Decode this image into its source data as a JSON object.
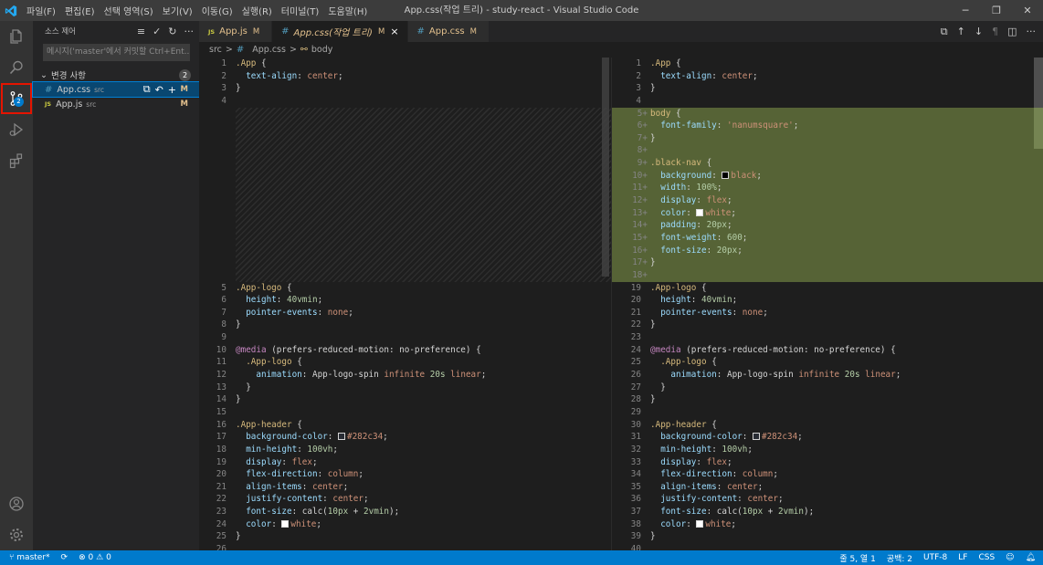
{
  "window": {
    "title": "App.css(작업 트리) - study-react - Visual Studio Code",
    "menu": [
      "파일(F)",
      "편집(E)",
      "선택 영역(S)",
      "보기(V)",
      "이동(G)",
      "실행(R)",
      "터미널(T)",
      "도움말(H)"
    ]
  },
  "activity": {
    "scm_badge": "2"
  },
  "sidebar": {
    "title": "소스 제어",
    "commit_placeholder": "메시지('master'에서 커밋할 Ctrl+Ent...",
    "changes_label": "변경 사항",
    "changes_count": "2",
    "files": [
      {
        "name": "App.css",
        "dir": "src",
        "status": "M",
        "type": "css",
        "selected": true
      },
      {
        "name": "App.js",
        "dir": "src",
        "status": "M",
        "type": "js",
        "selected": false
      }
    ]
  },
  "tabs": [
    {
      "badge": "JS",
      "label": "App.js",
      "mod": "M"
    },
    {
      "badge": "#",
      "label": "App.css(작업 트리)",
      "mod": "M",
      "close": "×"
    },
    {
      "badge": "#",
      "label": "App.css",
      "mod": "M"
    }
  ],
  "breadcrumb": {
    "folder": "src",
    "sep": ">",
    "file": "App.css",
    "symbol": "body"
  },
  "left_lines": {
    "top": [
      {
        "n": "1",
        "html": "<span class='sel'>.App</span> <span class='punc'>{</span>"
      },
      {
        "n": "2",
        "html": "  <span class='prop'>text-align</span><span class='punc'>:</span> <span class='val'>center</span><span class='punc'>;</span>"
      },
      {
        "n": "3",
        "html": "<span class='punc'>}</span>"
      },
      {
        "n": "4",
        "html": ""
      }
    ],
    "bottom": [
      {
        "n": "5",
        "html": "<span class='sel'>.App-logo</span> <span class='punc'>{</span>"
      },
      {
        "n": "6",
        "html": "  <span class='prop'>height</span><span class='punc'>:</span> <span class='num'>40vmin</span><span class='punc'>;</span>"
      },
      {
        "n": "7",
        "html": "  <span class='prop'>pointer-events</span><span class='punc'>:</span> <span class='val'>none</span><span class='punc'>;</span>"
      },
      {
        "n": "8",
        "html": "<span class='punc'>}</span>"
      },
      {
        "n": "9",
        "html": ""
      },
      {
        "n": "10",
        "html": "<span class='at'>@media</span> <span class='punc'>(prefers-reduced-motion: no-preference) {</span>"
      },
      {
        "n": "11",
        "html": "  <span class='sel'>.App-logo</span> <span class='punc'>{</span>"
      },
      {
        "n": "12",
        "html": "    <span class='prop'>animation</span><span class='punc'>:</span> <span class='punc'>App-logo-spin</span> <span class='val'>infinite</span> <span class='num'>20s</span> <span class='val'>linear</span><span class='punc'>;</span>"
      },
      {
        "n": "13",
        "html": "  <span class='punc'>}</span>"
      },
      {
        "n": "14",
        "html": "<span class='punc'>}</span>"
      },
      {
        "n": "15",
        "html": ""
      },
      {
        "n": "16",
        "html": "<span class='sel'>.App-header</span> <span class='punc'>{</span>"
      },
      {
        "n": "17",
        "html": "  <span class='prop'>background-color</span><span class='punc'>:</span> <span class='swatch' style='background:#282c34'></span><span class='val'>#282c34</span><span class='punc'>;</span>"
      },
      {
        "n": "18",
        "html": "  <span class='prop'>min-height</span><span class='punc'>:</span> <span class='num'>100vh</span><span class='punc'>;</span>"
      },
      {
        "n": "19",
        "html": "  <span class='prop'>display</span><span class='punc'>:</span> <span class='val'>flex</span><span class='punc'>;</span>"
      },
      {
        "n": "20",
        "html": "  <span class='prop'>flex-direction</span><span class='punc'>:</span> <span class='val'>column</span><span class='punc'>;</span>"
      },
      {
        "n": "21",
        "html": "  <span class='prop'>align-items</span><span class='punc'>:</span> <span class='val'>center</span><span class='punc'>;</span>"
      },
      {
        "n": "22",
        "html": "  <span class='prop'>justify-content</span><span class='punc'>:</span> <span class='val'>center</span><span class='punc'>;</span>"
      },
      {
        "n": "23",
        "html": "  <span class='prop'>font-size</span><span class='punc'>:</span> <span class='punc'>calc(</span><span class='num'>10px</span> <span class='punc'>+</span> <span class='num'>2vmin</span><span class='punc'>);</span>"
      },
      {
        "n": "24",
        "html": "  <span class='prop'>color</span><span class='punc'>:</span> <span class='swatch' style='background:#ffffff'></span><span class='val'>white</span><span class='punc'>;</span>"
      },
      {
        "n": "25",
        "html": "<span class='punc'>}</span>"
      },
      {
        "n": "26",
        "html": ""
      }
    ]
  },
  "right_lines": [
    {
      "n": "1",
      "html": "<span class='sel'>.App</span> <span class='punc'>{</span>"
    },
    {
      "n": "2",
      "html": "  <span class='prop'>text-align</span><span class='punc'>:</span> <span class='val'>center</span><span class='punc'>;</span>"
    },
    {
      "n": "3",
      "html": "<span class='punc'>}</span>"
    },
    {
      "n": "4",
      "html": ""
    },
    {
      "n": "5",
      "add": true,
      "html": "<span class='sel'>body</span> <span class='punc'>{</span>"
    },
    {
      "n": "6",
      "add": true,
      "html": "  <span class='prop'>font-family</span><span class='punc'>:</span> <span class='val'>'nanumsquare'</span><span class='punc'>;</span>"
    },
    {
      "n": "7",
      "add": true,
      "html": "<span class='punc'>}</span>"
    },
    {
      "n": "8",
      "add": true,
      "html": ""
    },
    {
      "n": "9",
      "add": true,
      "html": "<span class='sel'>.black-nav</span> <span class='punc'>{</span>"
    },
    {
      "n": "10",
      "add": true,
      "html": "  <span class='prop'>background</span><span class='punc'>:</span> <span class='swatch' style='background:#000000'></span><span class='val'>black</span><span class='punc'>;</span>"
    },
    {
      "n": "11",
      "add": true,
      "html": "  <span class='prop'>width</span><span class='punc'>:</span> <span class='num'>100%</span><span class='punc'>;</span>"
    },
    {
      "n": "12",
      "add": true,
      "html": "  <span class='prop'>display</span><span class='punc'>:</span> <span class='val'>flex</span><span class='punc'>;</span>"
    },
    {
      "n": "13",
      "add": true,
      "html": "  <span class='prop'>color</span><span class='punc'>:</span> <span class='swatch' style='background:#ffffff'></span><span class='val'>white</span><span class='punc'>;</span>"
    },
    {
      "n": "14",
      "add": true,
      "html": "  <span class='prop'>padding</span><span class='punc'>:</span> <span class='num'>20px</span><span class='punc'>;</span>"
    },
    {
      "n": "15",
      "add": true,
      "html": "  <span class='prop'>font-weight</span><span class='punc'>:</span> <span class='num'>600</span><span class='punc'>;</span>"
    },
    {
      "n": "16",
      "add": true,
      "html": "  <span class='prop'>font-size</span><span class='punc'>:</span> <span class='num'>20px</span><span class='punc'>;</span>"
    },
    {
      "n": "17",
      "add": true,
      "html": "<span class='punc'>}</span>"
    },
    {
      "n": "18",
      "add": true,
      "html": ""
    },
    {
      "n": "19",
      "html": "<span class='sel'>.App-logo</span> <span class='punc'>{</span>"
    },
    {
      "n": "20",
      "html": "  <span class='prop'>height</span><span class='punc'>:</span> <span class='num'>40vmin</span><span class='punc'>;</span>"
    },
    {
      "n": "21",
      "html": "  <span class='prop'>pointer-events</span><span class='punc'>:</span> <span class='val'>none</span><span class='punc'>;</span>"
    },
    {
      "n": "22",
      "html": "<span class='punc'>}</span>"
    },
    {
      "n": "23",
      "html": ""
    },
    {
      "n": "24",
      "html": "<span class='at'>@media</span> <span class='punc'>(prefers-reduced-motion: no-preference) {</span>"
    },
    {
      "n": "25",
      "html": "  <span class='sel'>.App-logo</span> <span class='punc'>{</span>"
    },
    {
      "n": "26",
      "html": "    <span class='prop'>animation</span><span class='punc'>:</span> <span class='punc'>App-logo-spin</span> <span class='val'>infinite</span> <span class='num'>20s</span> <span class='val'>linear</span><span class='punc'>;</span>"
    },
    {
      "n": "27",
      "html": "  <span class='punc'>}</span>"
    },
    {
      "n": "28",
      "html": "<span class='punc'>}</span>"
    },
    {
      "n": "29",
      "html": ""
    },
    {
      "n": "30",
      "html": "<span class='sel'>.App-header</span> <span class='punc'>{</span>"
    },
    {
      "n": "31",
      "html": "  <span class='prop'>background-color</span><span class='punc'>:</span> <span class='swatch' style='background:#282c34'></span><span class='val'>#282c34</span><span class='punc'>;</span>"
    },
    {
      "n": "32",
      "html": "  <span class='prop'>min-height</span><span class='punc'>:</span> <span class='num'>100vh</span><span class='punc'>;</span>"
    },
    {
      "n": "33",
      "html": "  <span class='prop'>display</span><span class='punc'>:</span> <span class='val'>flex</span><span class='punc'>;</span>"
    },
    {
      "n": "34",
      "html": "  <span class='prop'>flex-direction</span><span class='punc'>:</span> <span class='val'>column</span><span class='punc'>;</span>"
    },
    {
      "n": "35",
      "html": "  <span class='prop'>align-items</span><span class='punc'>:</span> <span class='val'>center</span><span class='punc'>;</span>"
    },
    {
      "n": "36",
      "html": "  <span class='prop'>justify-content</span><span class='punc'>:</span> <span class='val'>center</span><span class='punc'>;</span>"
    },
    {
      "n": "37",
      "html": "  <span class='prop'>font-size</span><span class='punc'>:</span> <span class='punc'>calc(</span><span class='num'>10px</span> <span class='punc'>+</span> <span class='num'>2vmin</span><span class='punc'>);</span>"
    },
    {
      "n": "38",
      "html": "  <span class='prop'>color</span><span class='punc'>:</span> <span class='swatch' style='background:#ffffff'></span><span class='val'>white</span><span class='punc'>;</span>"
    },
    {
      "n": "39",
      "html": "<span class='punc'>}</span>"
    },
    {
      "n": "40",
      "html": ""
    }
  ],
  "status": {
    "branch": "master*",
    "errors": "0",
    "warnings": "0",
    "position": "줄 5, 열 1",
    "spaces": "공백: 2",
    "encoding": "UTF-8",
    "eol": "LF",
    "language": "CSS"
  }
}
